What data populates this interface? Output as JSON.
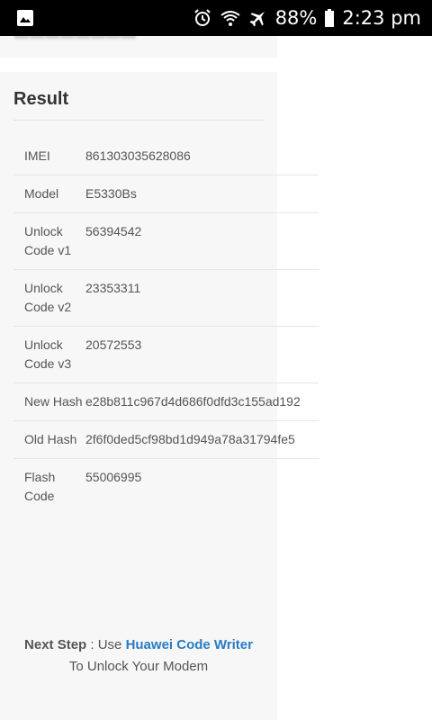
{
  "status_bar": {
    "icons": [
      "image-icon",
      "alarm-icon",
      "wifi-icon",
      "airplane-icon",
      "battery-icon"
    ],
    "battery": "88%",
    "time": "2:23 pm",
    "background": "#000000"
  },
  "result": {
    "title": "Result",
    "rows": [
      {
        "label": "IMEI",
        "value": "861303035628086"
      },
      {
        "label": "Model",
        "value": "E5330Bs"
      },
      {
        "label": "Unlock Code v1",
        "value": "56394542"
      },
      {
        "label": "Unlock Code v2",
        "value": "23353311"
      },
      {
        "label": "Unlock Code v3",
        "value": "20572553"
      },
      {
        "label": "New Hash",
        "value": "e28b811c967d4d686f0dfd3c155ad192"
      },
      {
        "label": "Old Hash",
        "value": "2f6f0ded5cf98bd1d949a78a31794fe5"
      },
      {
        "label": "Flash Code",
        "value": "55006995"
      }
    ]
  },
  "next_step": {
    "prefix": "Next Step",
    "separator": " : Use ",
    "link_text": "Huawei Code Writer",
    "suffix": "To Unlock Your Modem"
  },
  "colors": {
    "panel_background": "#f7f7f7",
    "link": "#2b7bc4",
    "text": "#555555"
  }
}
